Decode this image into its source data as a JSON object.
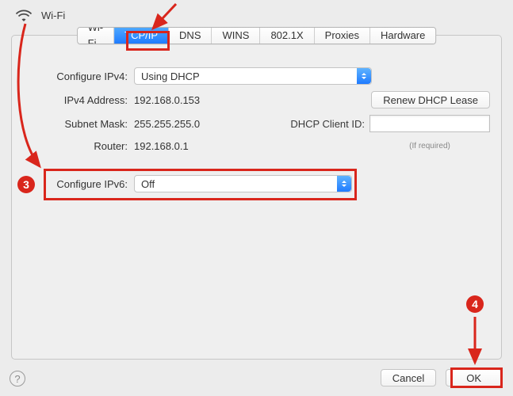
{
  "header": {
    "title": "Wi-Fi"
  },
  "tabs": [
    {
      "label": "Wi-Fi",
      "active": false
    },
    {
      "label": "TCP/IP",
      "active": true
    },
    {
      "label": "DNS",
      "active": false
    },
    {
      "label": "WINS",
      "active": false
    },
    {
      "label": "802.1X",
      "active": false
    },
    {
      "label": "Proxies",
      "active": false
    },
    {
      "label": "Hardware",
      "active": false
    }
  ],
  "ipv4": {
    "configure_label": "Configure IPv4:",
    "configure_value": "Using DHCP",
    "address_label": "IPv4 Address:",
    "address_value": "192.168.0.153",
    "subnet_label": "Subnet Mask:",
    "subnet_value": "255.255.255.0",
    "router_label": "Router:",
    "router_value": "192.168.0.1",
    "renew_button": "Renew DHCP Lease",
    "client_id_label": "DHCP Client ID:",
    "client_id_value": "",
    "client_id_hint": "(If required)"
  },
  "ipv6": {
    "configure_label": "Configure IPv6:",
    "configure_value": "Off"
  },
  "footer": {
    "cancel": "Cancel",
    "ok": "OK",
    "help": "?"
  },
  "annotations": {
    "step3": "3",
    "step4": "4"
  }
}
